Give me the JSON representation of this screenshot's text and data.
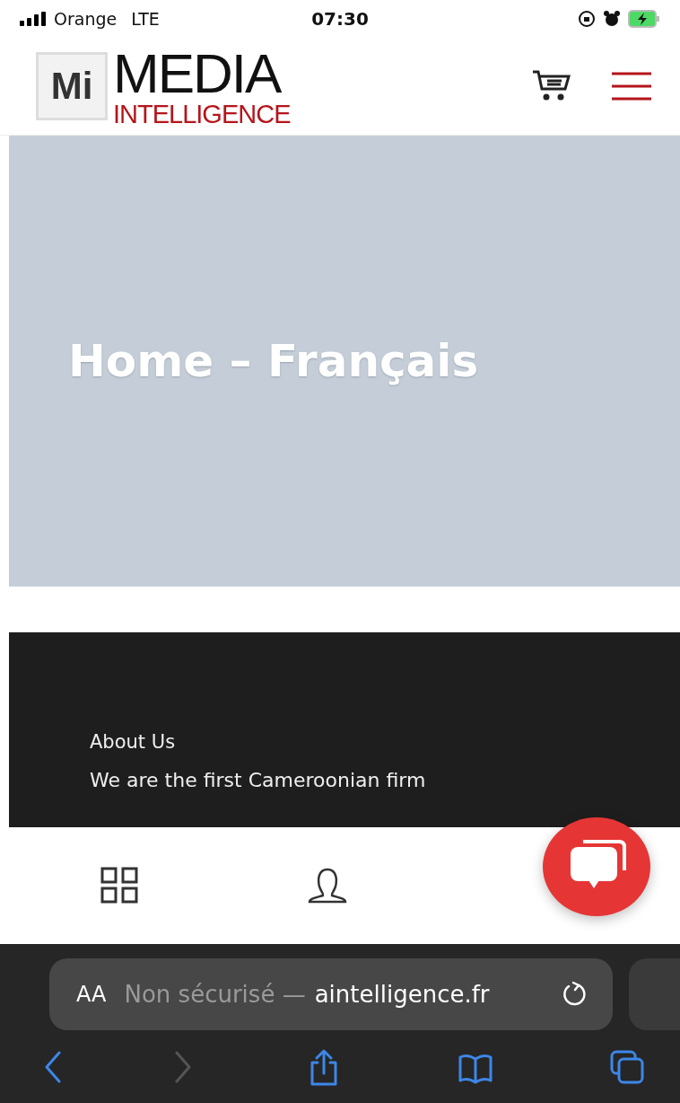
{
  "status_bar": {
    "carrier": "Orange",
    "network": "LTE",
    "time": "07:30",
    "battery_charging": true
  },
  "header": {
    "logo": {
      "initials": "Mi",
      "word": "MEDIA",
      "subword": "INTELLIGENCE"
    }
  },
  "hero": {
    "title": "Home – Français"
  },
  "footer": {
    "heading": "About Us",
    "text": "We are the first Cameroonian firm"
  },
  "bottom_nav": [
    {
      "kind": "grid"
    },
    {
      "kind": "account"
    }
  ],
  "browser": {
    "address": {
      "text_size": "AA",
      "security": "Non sécurisé —",
      "domain": "aintelligence.fr"
    },
    "toolbar": [
      {
        "kind": "back",
        "disabled": false
      },
      {
        "kind": "forward",
        "disabled": true
      },
      {
        "kind": "share",
        "disabled": false
      },
      {
        "kind": "bookmarks",
        "disabled": false
      },
      {
        "kind": "tabs",
        "disabled": false
      }
    ]
  }
}
